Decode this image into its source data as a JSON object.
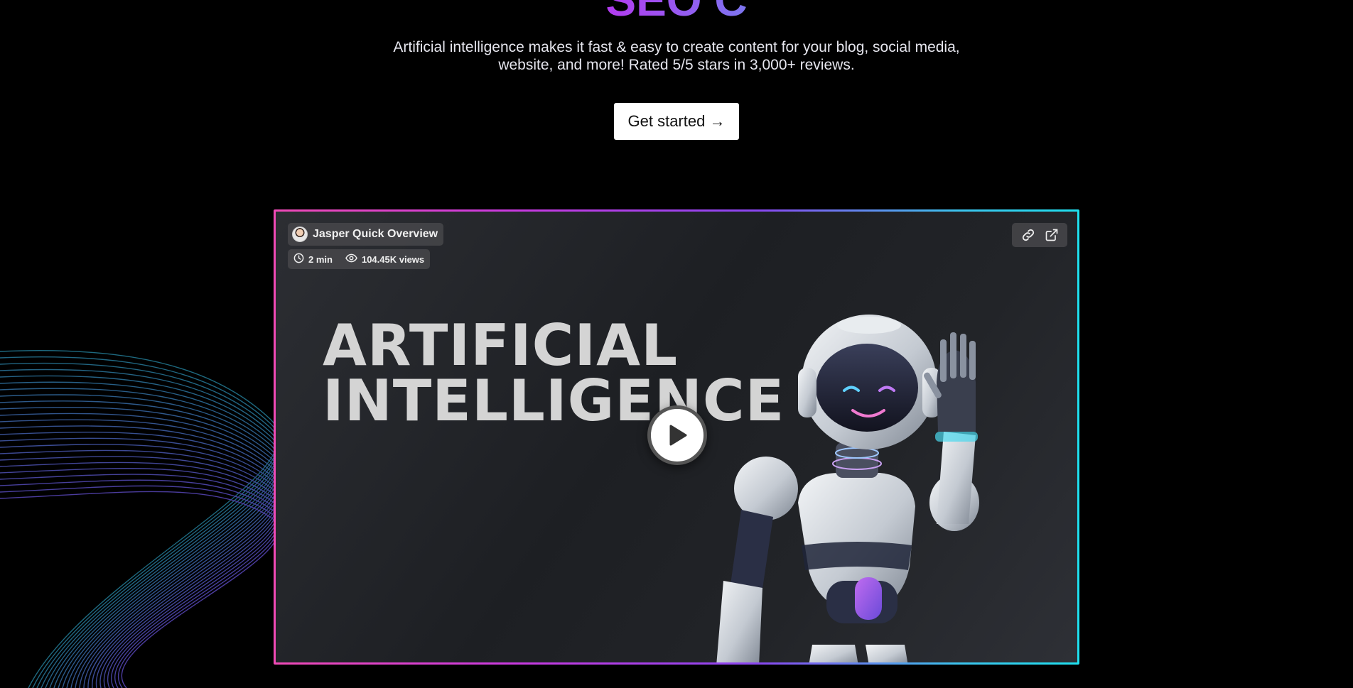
{
  "hero": {
    "title_partial": "SEO C",
    "subtitle": "Artificial intelligence makes it fast & easy to create content for your blog, social media, website, and more! Rated 5/5 stars in 3,000+ reviews.",
    "cta_label": "Get started →"
  },
  "video": {
    "title": "Jasper Quick Overview",
    "duration": "2 min",
    "views": "104.45K views",
    "headline_line1": "ARTIFICIAL",
    "headline_line2": "INTELLIGENCE",
    "actions": [
      "link-icon",
      "external-link-icon"
    ],
    "play_icon": "play-icon"
  },
  "colors": {
    "background": "#000000",
    "border_gradient": [
      "#f04ab6",
      "#c93ae0",
      "#8a46f0",
      "#3cc4ee",
      "#1fe0ef"
    ],
    "cta_background": "#ffffff"
  }
}
